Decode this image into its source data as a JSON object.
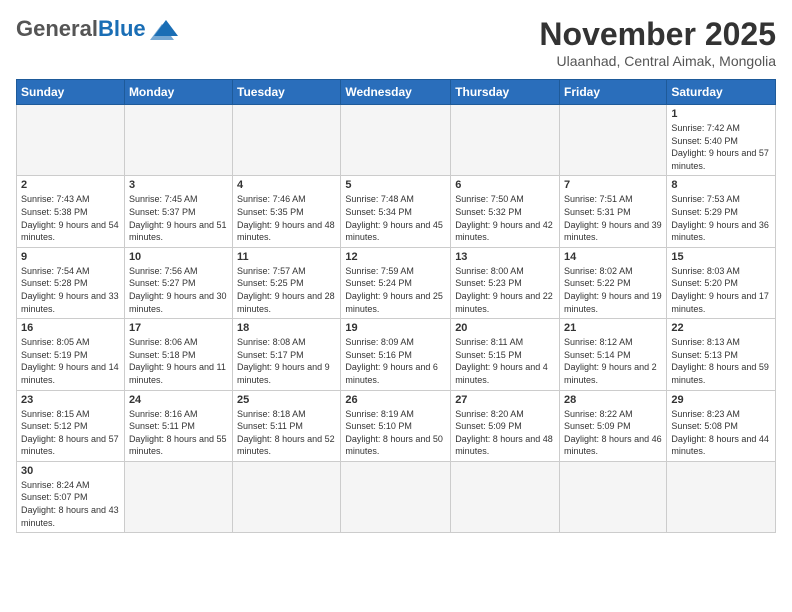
{
  "header": {
    "logo": {
      "general": "General",
      "blue": "Blue"
    },
    "title": "November 2025",
    "location": "Ulaanhad, Central Aimak, Mongolia"
  },
  "weekdays": [
    "Sunday",
    "Monday",
    "Tuesday",
    "Wednesday",
    "Thursday",
    "Friday",
    "Saturday"
  ],
  "days": {
    "d1": {
      "num": "1",
      "sunrise": "7:42 AM",
      "sunset": "5:40 PM",
      "daylight": "9 hours and 57 minutes."
    },
    "d2": {
      "num": "2",
      "sunrise": "7:43 AM",
      "sunset": "5:38 PM",
      "daylight": "9 hours and 54 minutes."
    },
    "d3": {
      "num": "3",
      "sunrise": "7:45 AM",
      "sunset": "5:37 PM",
      "daylight": "9 hours and 51 minutes."
    },
    "d4": {
      "num": "4",
      "sunrise": "7:46 AM",
      "sunset": "5:35 PM",
      "daylight": "9 hours and 48 minutes."
    },
    "d5": {
      "num": "5",
      "sunrise": "7:48 AM",
      "sunset": "5:34 PM",
      "daylight": "9 hours and 45 minutes."
    },
    "d6": {
      "num": "6",
      "sunrise": "7:50 AM",
      "sunset": "5:32 PM",
      "daylight": "9 hours and 42 minutes."
    },
    "d7": {
      "num": "7",
      "sunrise": "7:51 AM",
      "sunset": "5:31 PM",
      "daylight": "9 hours and 39 minutes."
    },
    "d8": {
      "num": "8",
      "sunrise": "7:53 AM",
      "sunset": "5:29 PM",
      "daylight": "9 hours and 36 minutes."
    },
    "d9": {
      "num": "9",
      "sunrise": "7:54 AM",
      "sunset": "5:28 PM",
      "daylight": "9 hours and 33 minutes."
    },
    "d10": {
      "num": "10",
      "sunrise": "7:56 AM",
      "sunset": "5:27 PM",
      "daylight": "9 hours and 30 minutes."
    },
    "d11": {
      "num": "11",
      "sunrise": "7:57 AM",
      "sunset": "5:25 PM",
      "daylight": "9 hours and 28 minutes."
    },
    "d12": {
      "num": "12",
      "sunrise": "7:59 AM",
      "sunset": "5:24 PM",
      "daylight": "9 hours and 25 minutes."
    },
    "d13": {
      "num": "13",
      "sunrise": "8:00 AM",
      "sunset": "5:23 PM",
      "daylight": "9 hours and 22 minutes."
    },
    "d14": {
      "num": "14",
      "sunrise": "8:02 AM",
      "sunset": "5:22 PM",
      "daylight": "9 hours and 19 minutes."
    },
    "d15": {
      "num": "15",
      "sunrise": "8:03 AM",
      "sunset": "5:20 PM",
      "daylight": "9 hours and 17 minutes."
    },
    "d16": {
      "num": "16",
      "sunrise": "8:05 AM",
      "sunset": "5:19 PM",
      "daylight": "9 hours and 14 minutes."
    },
    "d17": {
      "num": "17",
      "sunrise": "8:06 AM",
      "sunset": "5:18 PM",
      "daylight": "9 hours and 11 minutes."
    },
    "d18": {
      "num": "18",
      "sunrise": "8:08 AM",
      "sunset": "5:17 PM",
      "daylight": "9 hours and 9 minutes."
    },
    "d19": {
      "num": "19",
      "sunrise": "8:09 AM",
      "sunset": "5:16 PM",
      "daylight": "9 hours and 6 minutes."
    },
    "d20": {
      "num": "20",
      "sunrise": "8:11 AM",
      "sunset": "5:15 PM",
      "daylight": "9 hours and 4 minutes."
    },
    "d21": {
      "num": "21",
      "sunrise": "8:12 AM",
      "sunset": "5:14 PM",
      "daylight": "9 hours and 2 minutes."
    },
    "d22": {
      "num": "22",
      "sunrise": "8:13 AM",
      "sunset": "5:13 PM",
      "daylight": "8 hours and 59 minutes."
    },
    "d23": {
      "num": "23",
      "sunrise": "8:15 AM",
      "sunset": "5:12 PM",
      "daylight": "8 hours and 57 minutes."
    },
    "d24": {
      "num": "24",
      "sunrise": "8:16 AM",
      "sunset": "5:11 PM",
      "daylight": "8 hours and 55 minutes."
    },
    "d25": {
      "num": "25",
      "sunrise": "8:18 AM",
      "sunset": "5:11 PM",
      "daylight": "8 hours and 52 minutes."
    },
    "d26": {
      "num": "26",
      "sunrise": "8:19 AM",
      "sunset": "5:10 PM",
      "daylight": "8 hours and 50 minutes."
    },
    "d27": {
      "num": "27",
      "sunrise": "8:20 AM",
      "sunset": "5:09 PM",
      "daylight": "8 hours and 48 minutes."
    },
    "d28": {
      "num": "28",
      "sunrise": "8:22 AM",
      "sunset": "5:09 PM",
      "daylight": "8 hours and 46 minutes."
    },
    "d29": {
      "num": "29",
      "sunrise": "8:23 AM",
      "sunset": "5:08 PM",
      "daylight": "8 hours and 44 minutes."
    },
    "d30": {
      "num": "30",
      "sunrise": "8:24 AM",
      "sunset": "5:07 PM",
      "daylight": "8 hours and 43 minutes."
    }
  },
  "labels": {
    "sunrise": "Sunrise:",
    "sunset": "Sunset:",
    "daylight": "Daylight:"
  }
}
